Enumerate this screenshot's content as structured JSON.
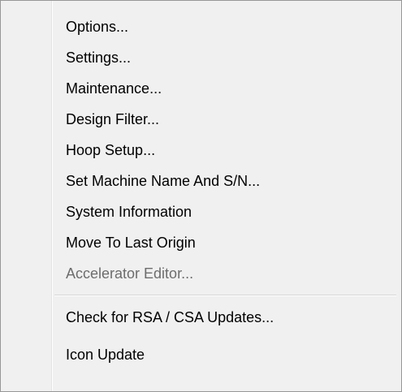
{
  "menu": {
    "items": [
      {
        "label": "Options..."
      },
      {
        "label": "Settings..."
      },
      {
        "label": "Maintenance..."
      },
      {
        "label": "Design Filter..."
      },
      {
        "label": "Hoop Setup..."
      },
      {
        "label": "Set Machine Name And  S/N..."
      },
      {
        "label": "System Information"
      },
      {
        "label": "Move To Last Origin"
      },
      {
        "label": "Accelerator Editor...",
        "disabled": true
      },
      {
        "label": "Check for RSA / CSA Updates..."
      },
      {
        "label": "Icon Update"
      }
    ]
  }
}
